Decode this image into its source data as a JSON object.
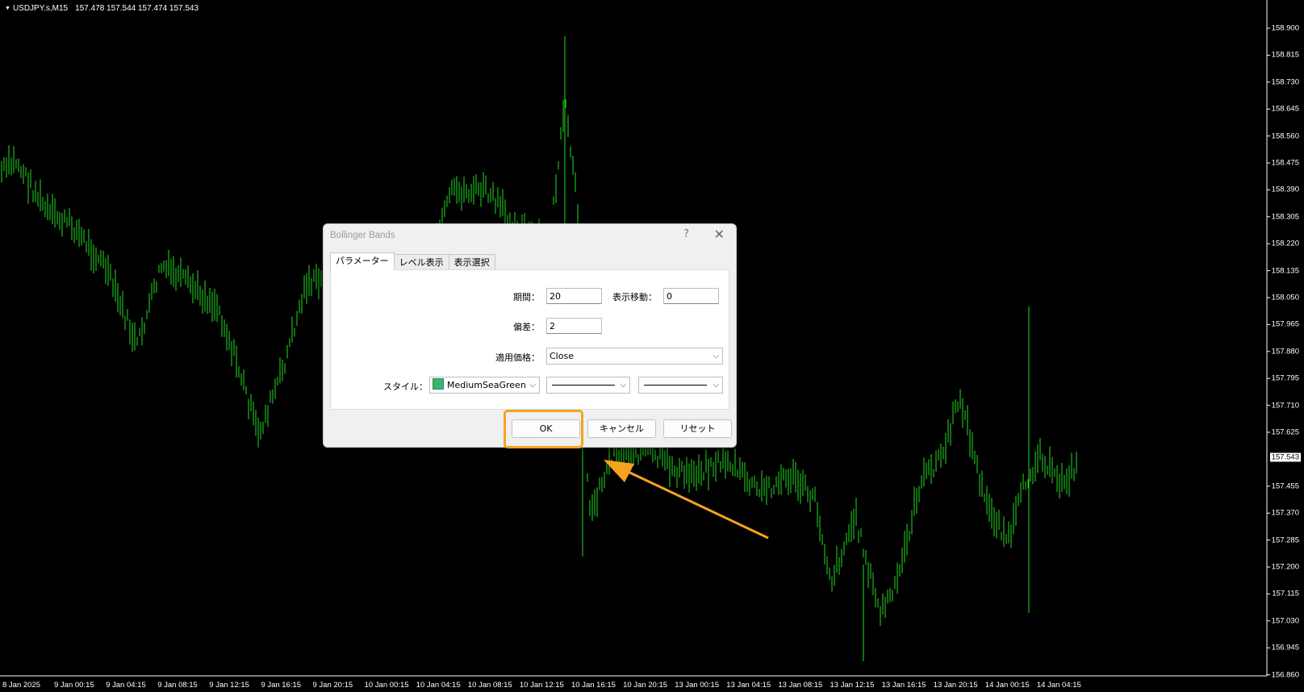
{
  "chart": {
    "symbol_info": "USDJPY.s,M15",
    "prices_header": "157.478 157.544 157.474 157.543",
    "current_price": "157.543",
    "price_axis": [
      "158.900",
      "158.815",
      "158.730",
      "158.645",
      "158.560",
      "158.475",
      "158.390",
      "158.305",
      "158.220",
      "158.135",
      "158.050",
      "157.965",
      "157.880",
      "157.795",
      "157.710",
      "157.625",
      "157.455",
      "157.370",
      "157.285",
      "157.200",
      "157.115",
      "157.030",
      "156.945",
      "156.860"
    ],
    "time_axis": [
      "8 Jan 2025",
      "9 Jan 00:15",
      "9 Jan 04:15",
      "9 Jan 08:15",
      "9 Jan 12:15",
      "9 Jan 16:15",
      "9 Jan 20:15",
      "10 Jan 00:15",
      "10 Jan 04:15",
      "10 Jan 08:15",
      "10 Jan 12:15",
      "10 Jan 16:15",
      "10 Jan 20:15",
      "13 Jan 00:15",
      "13 Jan 04:15",
      "13 Jan 08:15",
      "13 Jan 12:15",
      "13 Jan 16:15",
      "13 Jan 20:15",
      "14 Jan 00:15",
      "14 Jan 04:15"
    ],
    "bar_color": "#22dd22"
  },
  "dialog": {
    "title": "Bollinger Bands",
    "help_label": "?",
    "close_label": "✕",
    "tabs": [
      {
        "label": "パラメーター",
        "active": true
      },
      {
        "label": "レベル表示",
        "active": false
      },
      {
        "label": "表示選択",
        "active": false
      }
    ],
    "period_label": "期間：",
    "period_value": "20",
    "shift_label": "表示移動：",
    "shift_value": "0",
    "deviation_label": "偏差：",
    "deviation_value": "2",
    "apply_label": "適用価格：",
    "apply_value": "Close",
    "style_label": "スタイル：",
    "style_color_name": "MediumSeaGreen",
    "style_color": "#3cb371",
    "ok_label": "OK",
    "cancel_label": "キャンセル",
    "reset_label": "リセット"
  },
  "annotation": {
    "highlight_color": "#f5a31f"
  }
}
